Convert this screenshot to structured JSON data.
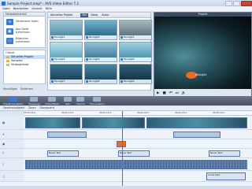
{
  "window": {
    "title": "Sample Project.mep* - AVS Video Editor 7.1"
  },
  "menu": [
    "Datei",
    "Bearbeiten",
    "Ansicht",
    "Hilfe"
  ],
  "left": {
    "header": "Mediabibliothek",
    "actions": [
      "Medienaten laden",
      "Vom Gerät aufnehmen",
      "Bildschirm aufnehmen"
    ],
    "orders_label": "Ordner",
    "folders": [
      "Aktuelles Projekt",
      "Samples",
      "Hintergründe"
    ],
    "bottom": [
      "Hinzufügen",
      "Entfernen"
    ]
  },
  "media": {
    "header": "Aktuelles Projekt",
    "tabs": [
      "Alle",
      "Video",
      "Audio"
    ],
    "thumbs": [
      "Diving01",
      "Diving02",
      "Diving03",
      "Diving04",
      "Diving05",
      "Diving06",
      "Diving07",
      "Diving08",
      "Diving09"
    ]
  },
  "preview": {
    "header": "Projekt",
    "clip_label": "Diving04",
    "time": "00:01:07.210 / 00:02:42.148"
  },
  "effects": [
    "Projekt bearbeiten",
    "Übergänge",
    "Videoeffekte",
    "Text",
    "Chroma",
    "Film erstellen"
  ],
  "timeline": {
    "tools": [
      "Geschwindigkeit",
      "Zoom",
      "Storyboard"
    ],
    "ticks": [
      "00:00:05.0",
      "00:00:10.0",
      "00:00:15.0",
      "00:00:20.0",
      "00:00:25.0",
      "00:00:30.0"
    ],
    "text_clips": [
      "Neuer Text",
      "Neuer Text",
      "Neuer Text"
    ],
    "audio_clip": "Arrow.mp3"
  }
}
